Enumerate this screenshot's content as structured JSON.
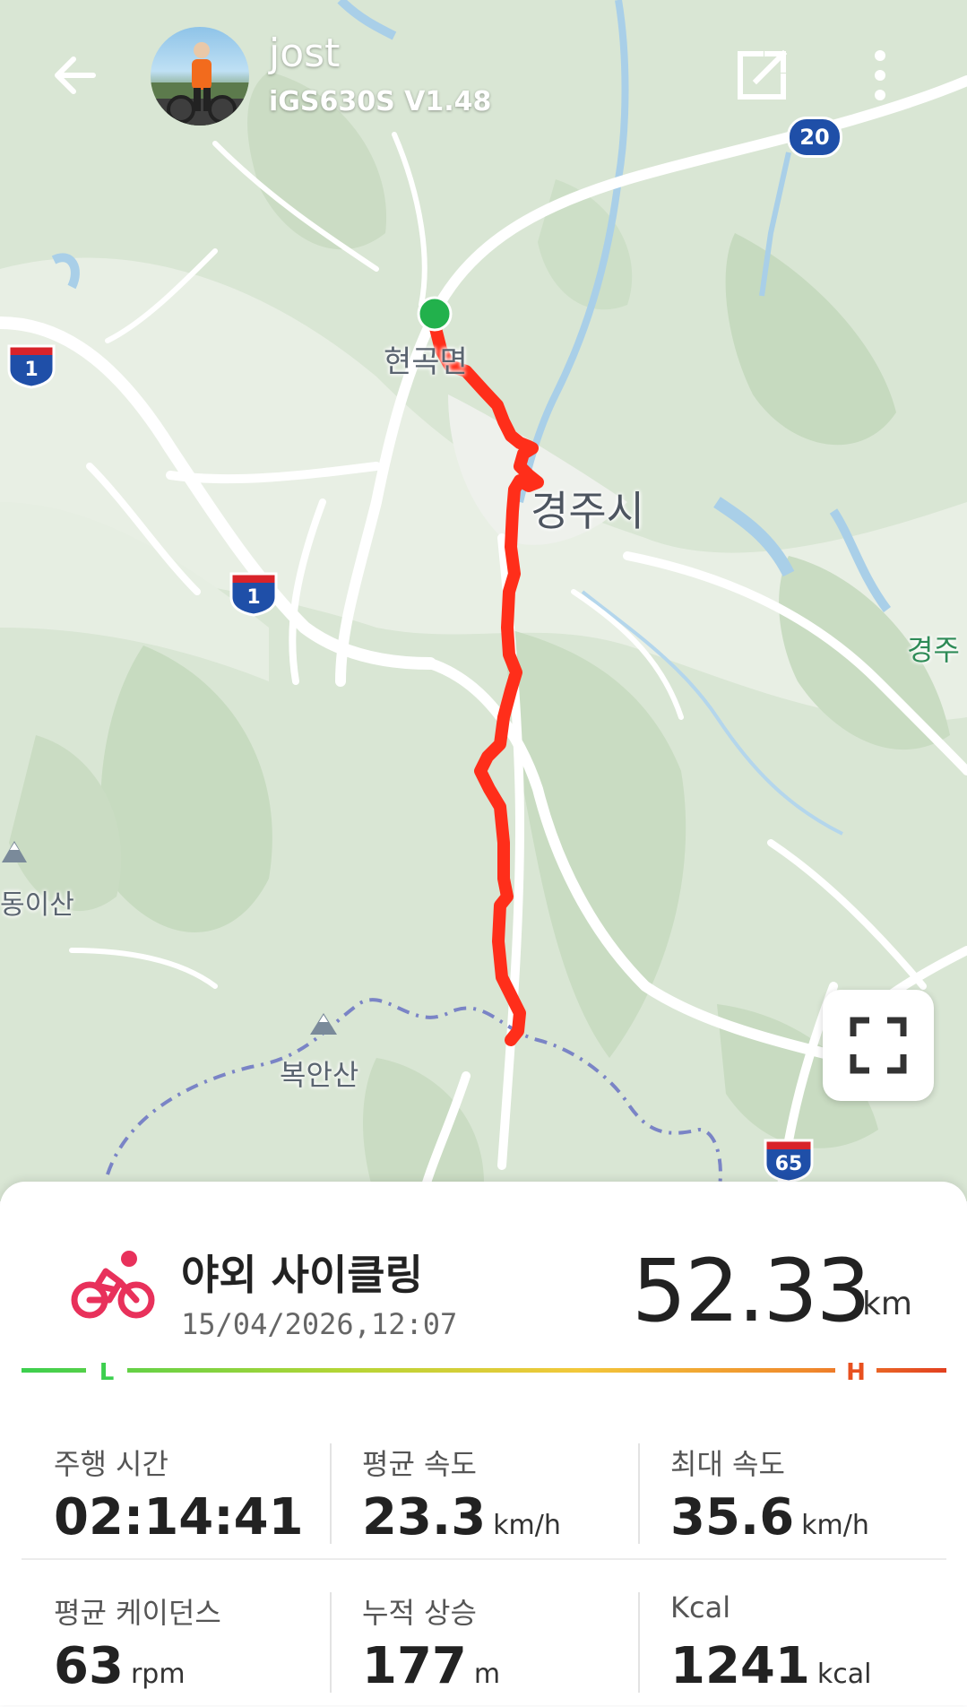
{
  "header": {
    "user_name": "jost",
    "device_name": "iGS630S  V1.48",
    "back_icon": "arrow-left-icon",
    "share_icon": "share-external-icon",
    "more_icon": "more-vertical-icon"
  },
  "map": {
    "labels": {
      "town_north": "현곡면",
      "city": "경주시",
      "east_edge": "경주",
      "mountain_west": "동이산",
      "mountain_south": "복안산"
    },
    "route_shields": {
      "interstate_1_a": "1",
      "interstate_1_b": "1",
      "route_20": "20",
      "interstate_65": "65"
    },
    "route_color": "#ff2e1a",
    "start_marker_color": "#22b14c",
    "fullscreen_icon": "fullscreen-icon"
  },
  "activity": {
    "icon": "bicycle-icon",
    "icon_color": "#e8315b",
    "title": "야외 사이클링",
    "date": "15/04/2026,12:07",
    "distance": "52.33",
    "distance_unit": "km",
    "intensity_low_label": "L",
    "intensity_high_label": "H"
  },
  "stats": [
    {
      "label": "주행 시간",
      "value": "02:14:41",
      "unit": ""
    },
    {
      "label": "평균 속도",
      "value": "23.3",
      "unit": "km/h"
    },
    {
      "label": "최대 속도",
      "value": "35.6",
      "unit": "km/h"
    },
    {
      "label": "평균 케이던스",
      "value": "63",
      "unit": "rpm"
    },
    {
      "label": "누적 상승",
      "value": "177",
      "unit": "m"
    },
    {
      "label": "Kcal",
      "value": "1241",
      "unit": "kcal"
    }
  ]
}
